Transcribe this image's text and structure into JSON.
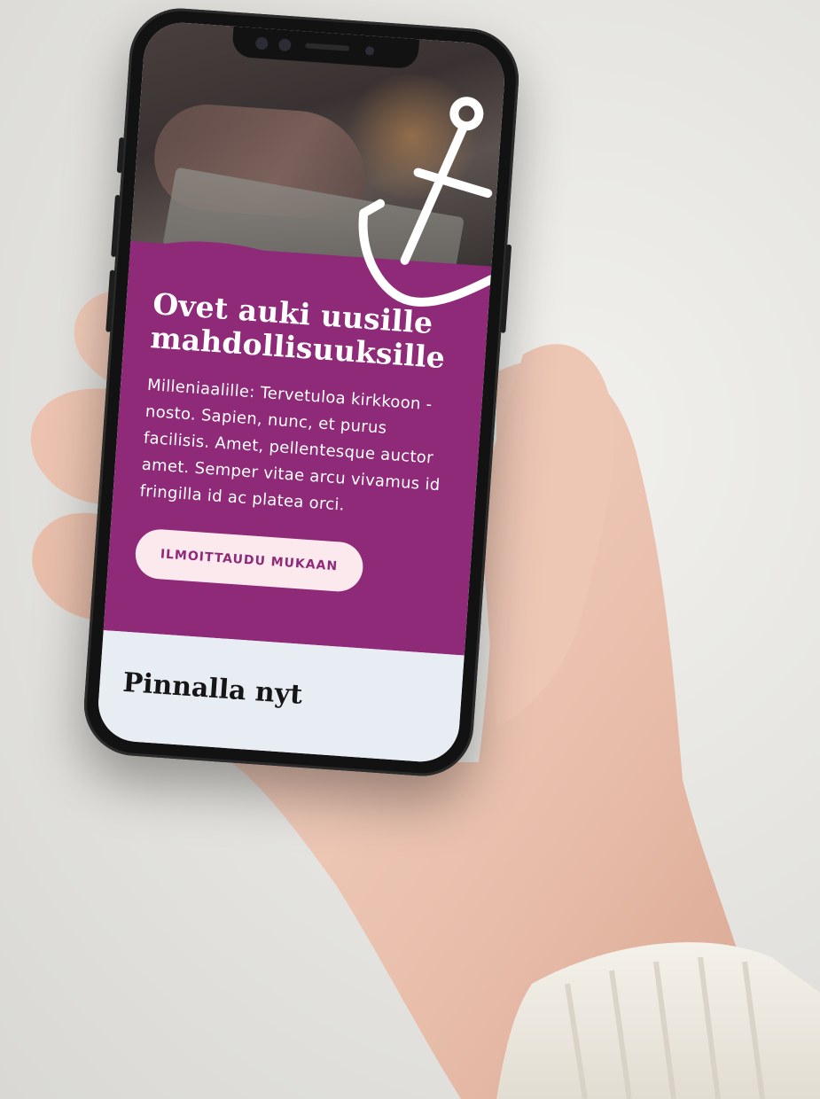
{
  "hero": {
    "title_line1": "Ovet auki uusille",
    "title_line2": "mahdollisuuksille",
    "text": "Milleniaalille: Tervetuloa kirkkoon - nosto. Sapien, nunc, et purus facilisis. Amet, pellentesque auctor amet. Semper vitae arcu vivamus id fringilla id ac platea orci.",
    "cta_label": "ILMOITTAUDU MUKAAN"
  },
  "section": {
    "title": "Pinnalla nyt"
  },
  "icons": {
    "anchor": "anchor-icon"
  },
  "colors": {
    "brand_purple": "#8e2a78",
    "cta_background": "#fbe9ee",
    "section_background": "#e8edf4",
    "heading_dark": "#161616"
  }
}
